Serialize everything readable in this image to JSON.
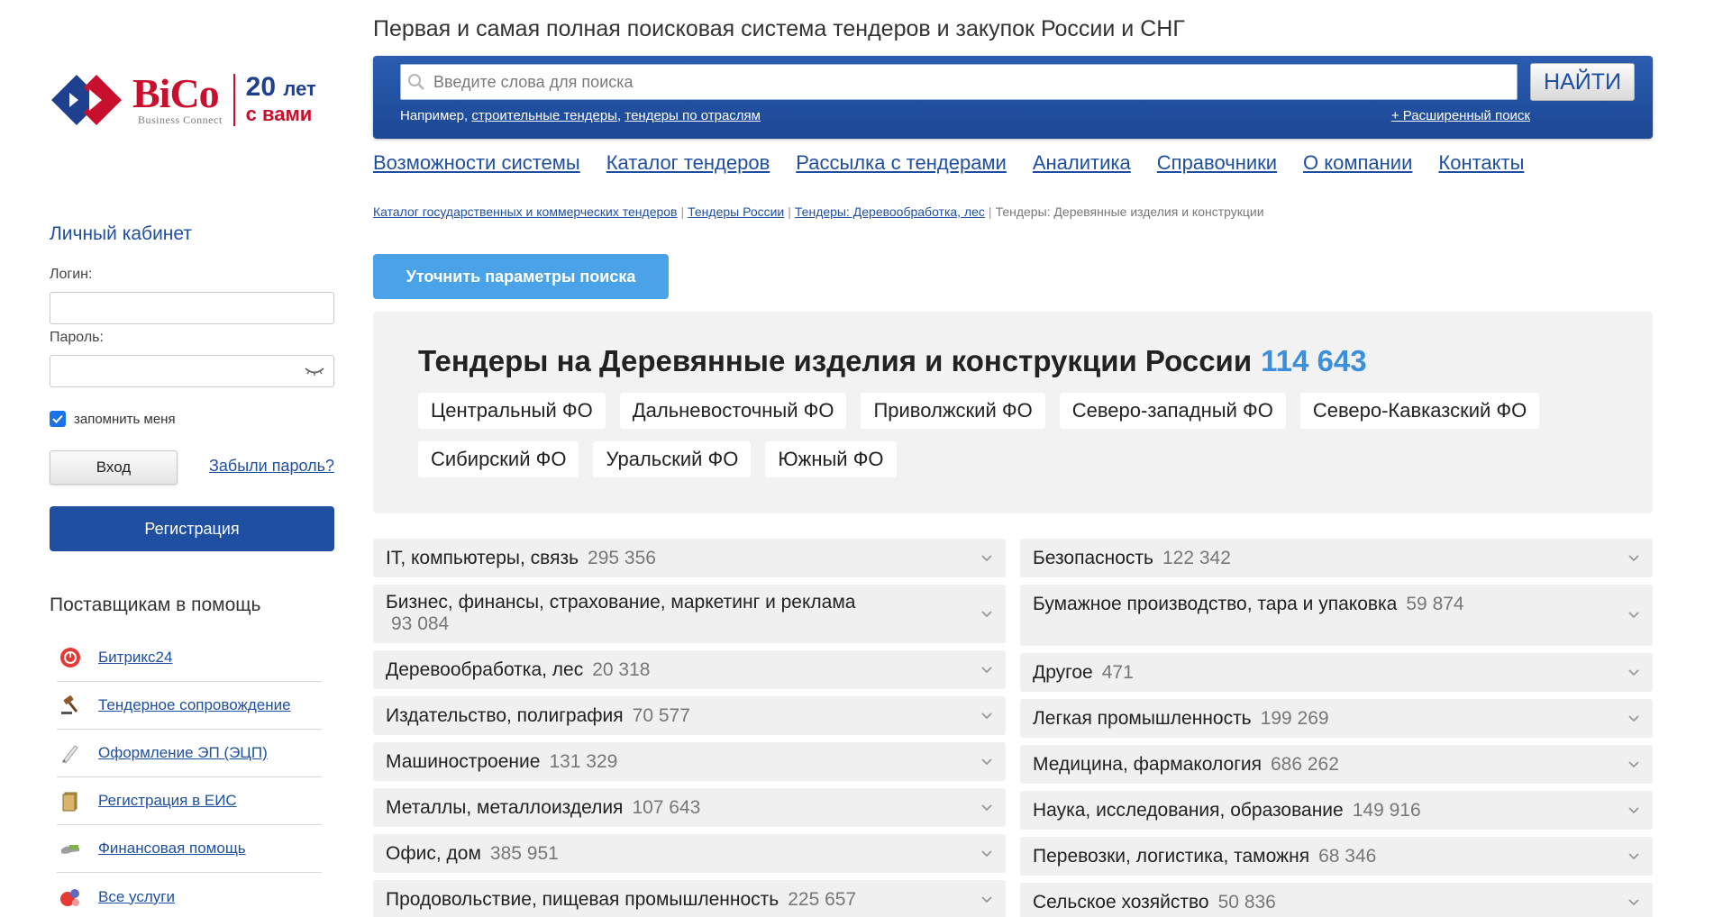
{
  "logo": {
    "brand": "BiCo",
    "brand_sub": "Business Connect",
    "years_num": "20",
    "years_word": "лет",
    "years_tail": "с вами"
  },
  "sidebar": {
    "cabinet_title": "Личный кабинет",
    "login_label": "Логин:",
    "password_label": "Пароль:",
    "remember_label": "запомнить меня",
    "login_button": "Вход",
    "forgot_link": "Забыли пароль?",
    "register_button": "Регистрация",
    "help_title": "Поставщикам в помощь",
    "help_items": [
      {
        "label": "Битрикс24",
        "icon": "bitrix-icon"
      },
      {
        "label": "Тендерное сопровождение",
        "icon": "gavel-icon"
      },
      {
        "label": "Оформление ЭП (ЭЦП)",
        "icon": "pen-icon"
      },
      {
        "label": "Регистрация в ЕИС",
        "icon": "document-icon"
      },
      {
        "label": "Финансовая помощь",
        "icon": "money-icon"
      },
      {
        "label": "Все услуги",
        "icon": "services-icon"
      }
    ]
  },
  "header": {
    "tagline": "Первая и самая полная поисковая система тендеров и закупок России и СНГ",
    "search_placeholder": "Введите слова для поиска",
    "search_button": "НАЙТИ",
    "hint_prefix": "Например,",
    "hint_link1": "строительные тендеры",
    "hint_link2": "тендеры по отраслям",
    "advanced_search": "+ Расширенный поиск"
  },
  "nav": [
    "Возможности системы",
    "Каталог тендеров",
    "Рассылка с тендерами",
    "Аналитика",
    "Справочники",
    "О компании",
    "Контакты"
  ],
  "breadcrumb": {
    "links": [
      "Каталог государственных и коммерческих тендеров",
      "Тендеры России",
      "Тендеры: Деревообработка, лес"
    ],
    "current": "Тендеры: Деревянные изделия и конструкции"
  },
  "refine_button": "Уточнить параметры поиска",
  "regions": {
    "title": "Тендеры на Деревянные изделия и конструкции России",
    "count": "114 643",
    "tags": [
      "Центральный ФО",
      "Дальневосточный ФО",
      "Приволжский ФО",
      "Северо-западный ФО",
      "Северо-Кавказский ФО",
      "Сибирский ФО",
      "Уральский ФО",
      "Южный ФО"
    ]
  },
  "categories_left": [
    {
      "name": "IT, компьютеры, связь",
      "count": "295 356"
    },
    {
      "name": "Бизнес, финансы, страхование, маркетинг и реклама",
      "count": "93 084"
    },
    {
      "name": "Деревообработка, лес",
      "count": "20 318"
    },
    {
      "name": "Издательство, полиграфия",
      "count": "70 577"
    },
    {
      "name": "Машиностроение",
      "count": "131 329"
    },
    {
      "name": "Металлы, металлоизделия",
      "count": "107 643"
    },
    {
      "name": "Офис, дом",
      "count": "385 951"
    },
    {
      "name": "Продовольствие, пищевая промышленность",
      "count": "225 657"
    }
  ],
  "categories_right": [
    {
      "name": "Безопасность",
      "count": "122 342"
    },
    {
      "name": "Бумажное производство, тара и упаковка",
      "count": "59 874"
    },
    {
      "name": "Другое",
      "count": "471"
    },
    {
      "name": "Легкая промышленность",
      "count": "199 269"
    },
    {
      "name": "Медицина, фармакология",
      "count": "686 262"
    },
    {
      "name": "Наука, исследования, образование",
      "count": "149 916"
    },
    {
      "name": "Перевозки, логистика, таможня",
      "count": "68 346"
    },
    {
      "name": "Сельское хозяйство",
      "count": "50 836"
    }
  ],
  "colors": {
    "brand_blue": "#1f4fa0",
    "brand_red": "#c8102e",
    "accent": "#4aa3e8",
    "count_blue": "#3b8fdb"
  }
}
